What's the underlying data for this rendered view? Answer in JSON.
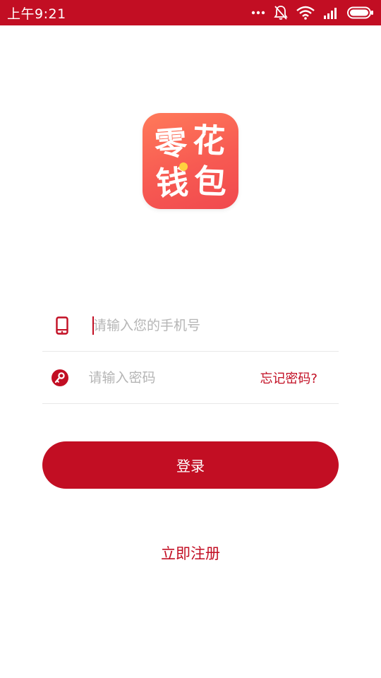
{
  "status_bar": {
    "time": "上午9:21",
    "icons": [
      "more-dots-icon",
      "mute-bell-icon",
      "wifi-icon",
      "signal-icon",
      "battery-icon"
    ],
    "background": "#c20e23"
  },
  "logo": {
    "chars": [
      "零",
      "花",
      "钱",
      "包"
    ],
    "gradient_start": "#ff7a5a",
    "gradient_end": "#f0494e"
  },
  "form": {
    "phone": {
      "placeholder": "请输入您的手机号",
      "value": "",
      "icon": "phone-icon"
    },
    "password": {
      "placeholder": "请输入密码",
      "value": "",
      "icon": "key-icon",
      "forgot_label": "忘记密码?"
    },
    "login_label": "登录"
  },
  "register_label": "立即注册",
  "colors": {
    "accent": "#c20e23",
    "placeholder": "#b5b5b5",
    "divider": "#e8e8e8"
  }
}
